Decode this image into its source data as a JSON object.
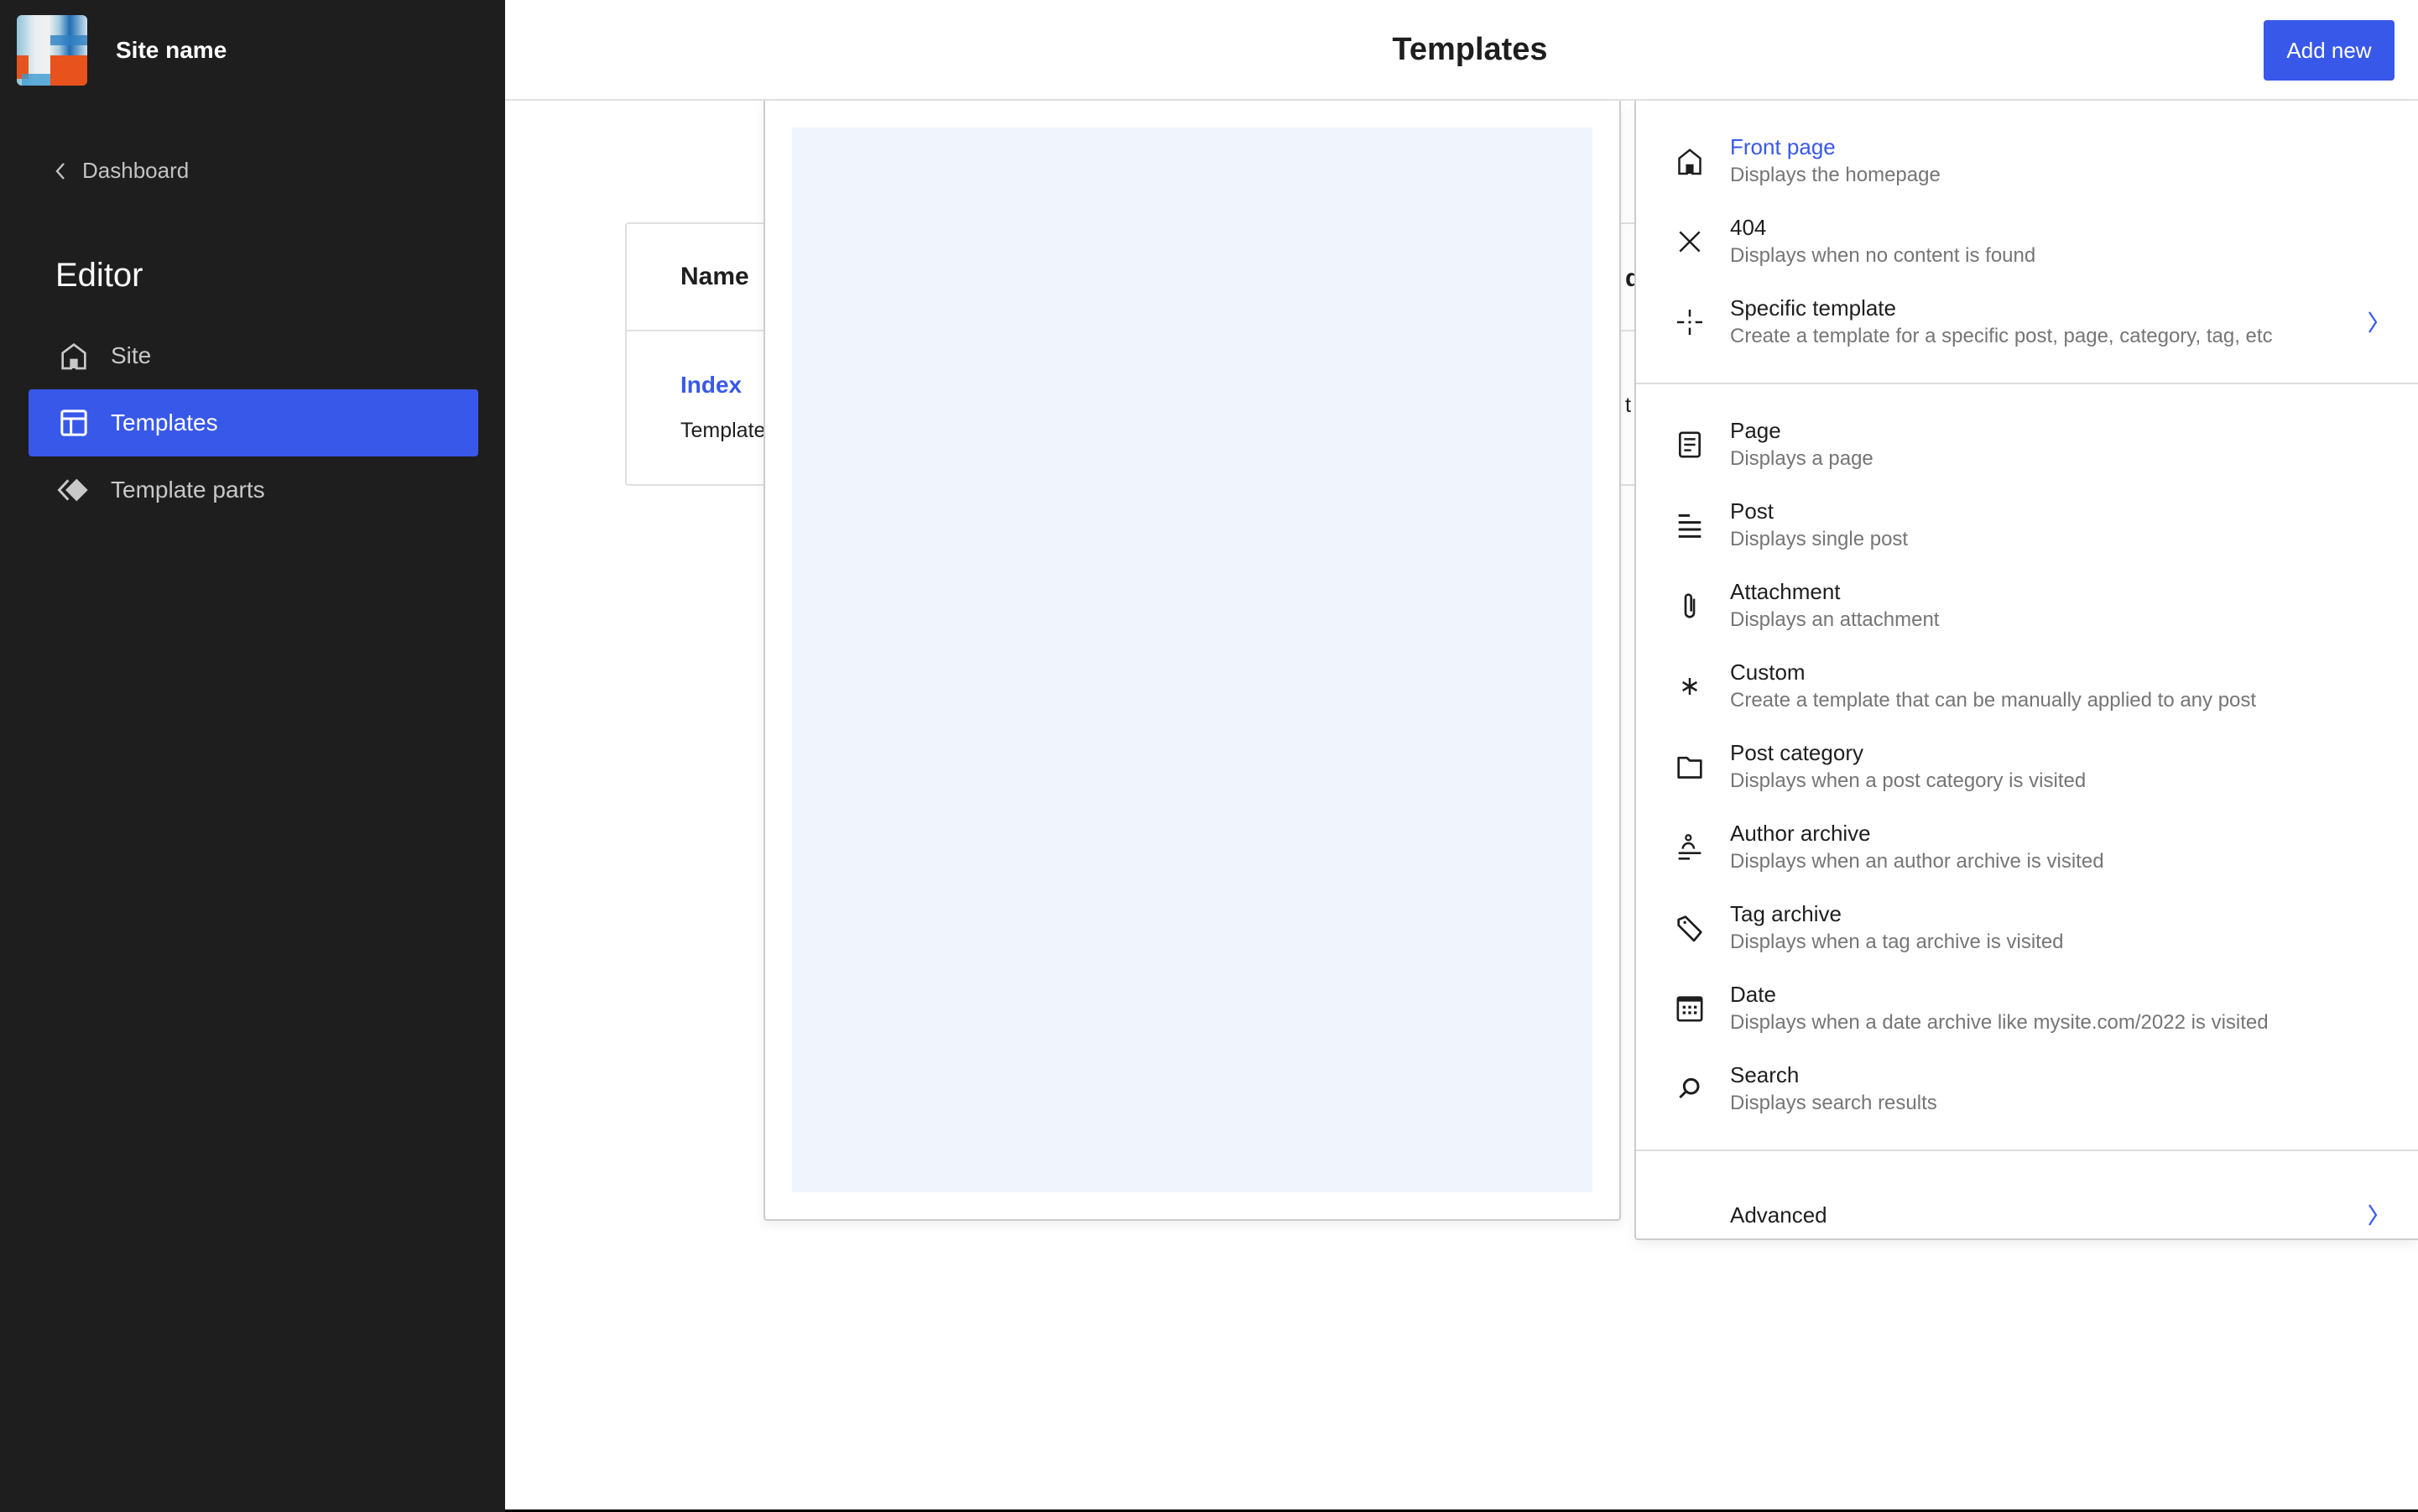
{
  "sidebar": {
    "site_name": "Site name",
    "back_label": "Dashboard",
    "section_title": "Editor",
    "items": [
      {
        "label": "Site",
        "icon": "home-icon",
        "active": false
      },
      {
        "label": "Templates",
        "icon": "layout-icon",
        "active": true
      },
      {
        "label": "Template parts",
        "icon": "symbol-filled-icon",
        "active": false
      }
    ]
  },
  "header": {
    "title": "Templates",
    "add_new_label": "Add new"
  },
  "table": {
    "columns": [
      "Name",
      "d"
    ],
    "rows": [
      {
        "name": "Index",
        "description": "Template",
        "col2": "t"
      }
    ]
  },
  "menu": {
    "groups": [
      [
        {
          "label": "Front page",
          "description": "Displays the homepage",
          "icon": "home-icon",
          "highlighted": true,
          "has_submenu": false
        },
        {
          "label": "404",
          "description": "Displays when no content is found",
          "icon": "close-icon",
          "highlighted": false,
          "has_submenu": false
        },
        {
          "label": "Specific template",
          "description": "Create a template for a specific post, page, category, tag, etc",
          "icon": "crosshair-icon",
          "highlighted": false,
          "has_submenu": true
        }
      ],
      [
        {
          "label": "Page",
          "description": "Displays a page",
          "icon": "page-icon"
        },
        {
          "label": "Post",
          "description": "Displays single post",
          "icon": "post-list-icon"
        },
        {
          "label": "Attachment",
          "description": "Displays an attachment",
          "icon": "paperclip-icon"
        },
        {
          "label": "Custom",
          "description": "Create a template that can be manually applied to any post",
          "icon": "asterisk-icon"
        },
        {
          "label": "Post category",
          "description": "Displays when a post category is visited",
          "icon": "folder-icon"
        },
        {
          "label": "Author archive",
          "description": "Displays when an author archive is visited",
          "icon": "author-icon"
        },
        {
          "label": "Tag archive",
          "description": "Displays when a tag archive is visited",
          "icon": "tag-icon"
        },
        {
          "label": "Date",
          "description": "Displays when a date archive like mysite.com/2022 is visited",
          "icon": "calendar-icon"
        },
        {
          "label": "Search",
          "description": "Displays search results",
          "icon": "search-icon"
        }
      ]
    ],
    "advanced_label": "Advanced"
  },
  "colors": {
    "accent": "#3858e9",
    "sidebar_bg": "#1e1e1e",
    "preview_bg": "#f0f5fd"
  }
}
